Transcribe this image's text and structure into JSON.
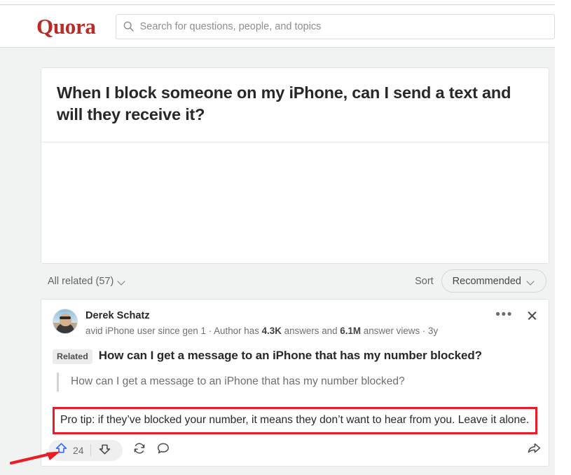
{
  "header": {
    "logo_text": "Quora",
    "search_placeholder": "Search for questions, people, and topics",
    "search_value": "",
    "search_icon": "search-icon"
  },
  "question": {
    "title": "When I block someone on my iPhone, can I send a text and will they receive it?"
  },
  "filter_bar": {
    "all_related_label": "All related (57)",
    "all_related_icon": "chevron-down-icon",
    "sort_label": "Sort",
    "sort_value": "Recommended",
    "sort_icon": "chevron-down-icon",
    "sort_options": [
      "Recommended"
    ]
  },
  "answer": {
    "author_name": "Derek Schatz",
    "credential_prefix": "avid iPhone user since gen 1 · Author has ",
    "answers_count": "4.3K",
    "credential_middle": " answers and ",
    "views_count": "6.1M",
    "credential_suffix": " answer views · 3y",
    "more_icon": "more-options-icon",
    "close_icon": "close-icon",
    "related_badge": "Related",
    "related_question": "How can I get a message to an iPhone that has my number blocked?",
    "quoted_question": "How can I get a message to an iPhone that has my number blocked?",
    "body_text": "Pro tip: if they’ve blocked your number, it means they don’t want to hear from you. Leave it alone.",
    "upvote_icon": "upvote-arrow-icon",
    "upvote_count": "24",
    "downvote_icon": "downvote-arrow-icon",
    "repost_icon": "repost-icon",
    "comment_icon": "comment-bubble-icon",
    "share_icon": "share-arrow-icon"
  },
  "annotation": {
    "highlight_color": "#ed1c24",
    "arrow_color": "#ed1c24",
    "upvote_accent_color": "#2e69ff"
  }
}
